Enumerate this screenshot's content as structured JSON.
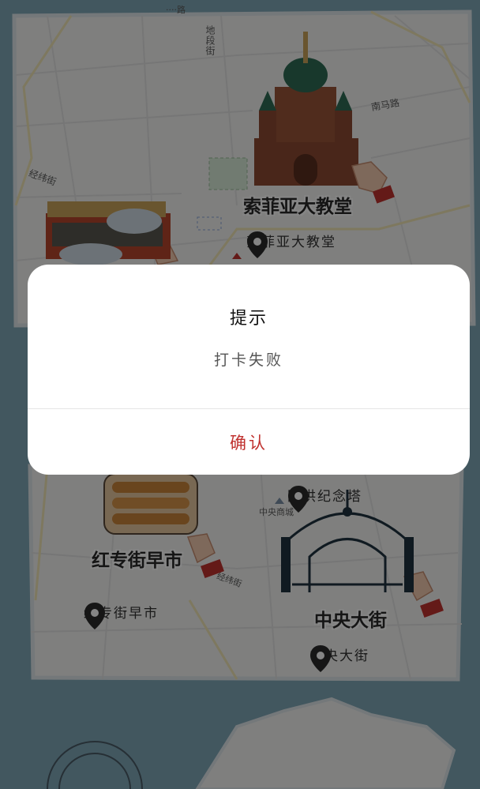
{
  "colors": {
    "accent": "#c0322f",
    "sea": "#7fa7b6",
    "land": "#f3f4f2",
    "overlay": "rgba(0,0,0,0.48)"
  },
  "map": {
    "streets": {
      "top_cut": "····路",
      "didu": "地段街",
      "nanma": "南马路",
      "jingwei": "经纬街",
      "zhongyang_mall": "中央商城",
      "jingwei2": "经纬街"
    },
    "landmarks": {
      "sofia_big": "索菲亚大教堂",
      "hongzhuan_big": "红专街早市",
      "zhongyang_big": "中央大街"
    },
    "pois": [
      {
        "name": "索菲亚大教堂",
        "icon": "map-pin-icon"
      },
      {
        "name": "防洪纪念塔",
        "icon": "map-pin-icon"
      },
      {
        "name": "红专街早市",
        "icon": "map-pin-icon"
      },
      {
        "name": "中央大街",
        "icon": "map-pin-icon"
      }
    ]
  },
  "dialog": {
    "title": "提示",
    "message": "打卡失败",
    "confirm_label": "确认"
  }
}
